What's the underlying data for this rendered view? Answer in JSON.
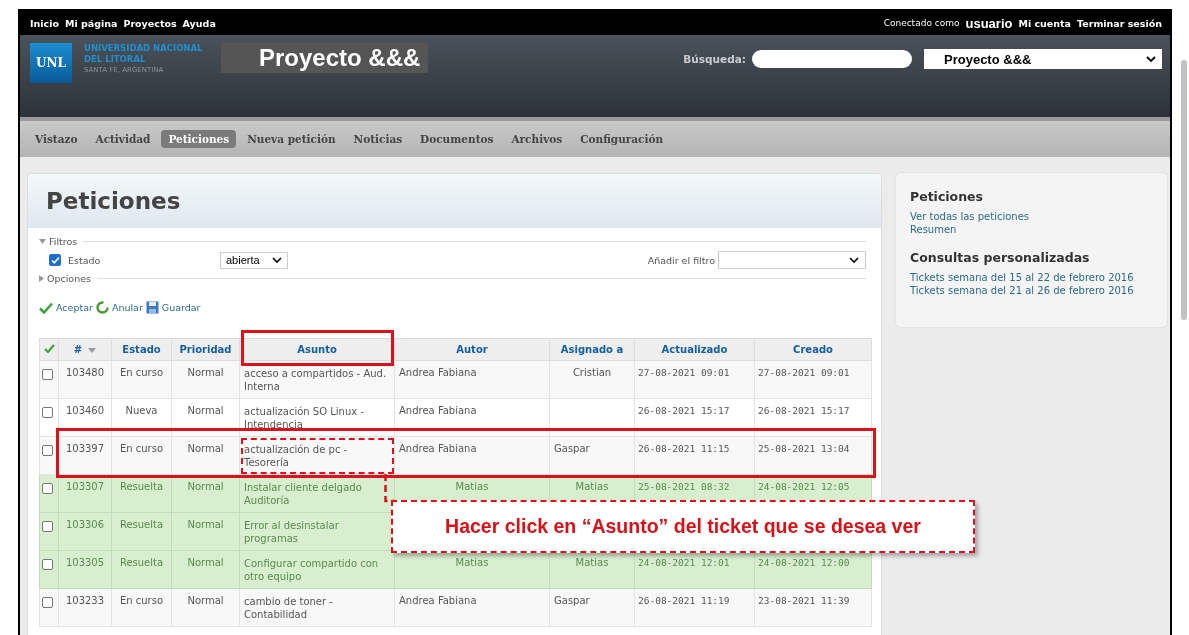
{
  "top_menu": [
    "Inicio",
    "Mi página",
    "Proyectos",
    "Ayuda"
  ],
  "account": {
    "prefix": "Conectado como",
    "user": "usuario",
    "links": [
      "Mi cuenta",
      "Terminar sesión"
    ]
  },
  "logo": {
    "badge": "UNL",
    "name_line1": "UNIVERSIDAD NACIONAL",
    "name_line2": "DEL LITORAL",
    "place": "SANTA FE, ARGENTINA"
  },
  "project_title": "Proyecto &&&",
  "search": {
    "label": "Búsqueda:",
    "project_select": "Proyecto &&&"
  },
  "tabs": [
    {
      "label": "Vistazo",
      "selected": false
    },
    {
      "label": "Actividad",
      "selected": false
    },
    {
      "label": "Peticiones",
      "selected": true
    },
    {
      "label": "Nueva petición",
      "selected": false
    },
    {
      "label": "Noticias",
      "selected": false
    },
    {
      "label": "Documentos",
      "selected": false
    },
    {
      "label": "Archivos",
      "selected": false
    },
    {
      "label": "Configuración",
      "selected": false
    }
  ],
  "page_title": "Peticiones",
  "filters": {
    "legend": "Filtros",
    "field": "Estado",
    "checked": true,
    "operator": "abierta",
    "add_label": "Añadir el filtro",
    "options_legend": "Opciones"
  },
  "actions": [
    "Aceptar",
    "Anular",
    "Guardar"
  ],
  "table": {
    "columns": [
      {
        "label": "#",
        "highlighted": false
      },
      {
        "label": "Estado",
        "highlighted": false
      },
      {
        "label": "Prioridad",
        "highlighted": false
      },
      {
        "label": "Asunto",
        "highlighted": true
      },
      {
        "label": "Autor",
        "highlighted": false
      },
      {
        "label": "Asignado a",
        "highlighted": false
      },
      {
        "label": "Actualizado",
        "highlighted": false
      },
      {
        "label": "Creado",
        "highlighted": false
      }
    ],
    "rows": [
      {
        "id": "103480",
        "status": "En curso",
        "priority": "Normal",
        "subject": "acceso a compartidos - Aud. Interna",
        "author": "Andrea Fabiana",
        "assignee": "Cristian",
        "updated": "27-08-2021 09:01",
        "created": "27-08-2021 09:01",
        "closed": false,
        "checked": false,
        "highlighted": false
      },
      {
        "id": "103460",
        "status": "Nueva",
        "priority": "Normal",
        "subject": "actualización SO Linux - Intendencia",
        "author": "Andrea Fabiana",
        "updated": "26-08-2021 15:17",
        "created": "26-08-2021 15:17",
        "closed": false,
        "checked": false,
        "highlighted": false
      },
      {
        "id": "103397",
        "status": "En curso",
        "priority": "Normal",
        "subject": "actualización de pc - Tesorería",
        "author": "Andrea Fabiana",
        "assignee": "Gaspar",
        "updated": "26-08-2021 11:15",
        "created": "25-08-2021 13:04",
        "closed": false,
        "checked": false,
        "highlighted": true
      },
      {
        "id": "103307",
        "status": "Resuelta",
        "priority": "Normal",
        "subject": "Instalar cliente delgado Auditoría",
        "author": "Matias",
        "assignee": "Matias",
        "updated": "25-08-2021 08:32",
        "created": "24-08-2021 12:05",
        "closed": true,
        "checked": false,
        "highlighted": false
      },
      {
        "id": "103306",
        "status": "Resuelta",
        "priority": "Normal",
        "subject": "Error al desinstalar programas",
        "closed": true,
        "checked": false,
        "highlighted": false
      },
      {
        "id": "103305",
        "status": "Resuelta",
        "priority": "Normal",
        "subject": "Configurar compartido con otro equipo",
        "author": "Matias",
        "assignee": "Matias",
        "updated": "24-08-2021 12:01",
        "created": "24-08-2021 12:00",
        "closed": true,
        "checked": false,
        "highlighted": false
      },
      {
        "id": "103233",
        "status": "En curso",
        "priority": "Normal",
        "subject": "cambio de toner - Contabilidad",
        "author": "Andrea Fabiana",
        "assignee": "Gaspar",
        "updated": "26-08-2021 11:19",
        "created": "23-08-2021 11:39",
        "closed": false,
        "checked": false,
        "highlighted": false
      }
    ]
  },
  "sidebar": {
    "sections": [
      {
        "title": "Peticiones",
        "links": [
          "Ver todas las peticiones",
          "Resumen"
        ]
      },
      {
        "title": "Consultas personalizadas",
        "links": [
          "Tickets semana del 15 al 22 de febrero 2016",
          "Tickets semana del 21 al 26 de febrero 2016"
        ]
      }
    ]
  },
  "annotation": {
    "text": "Hacer click en “Asunto” del ticket que se desea ver"
  }
}
